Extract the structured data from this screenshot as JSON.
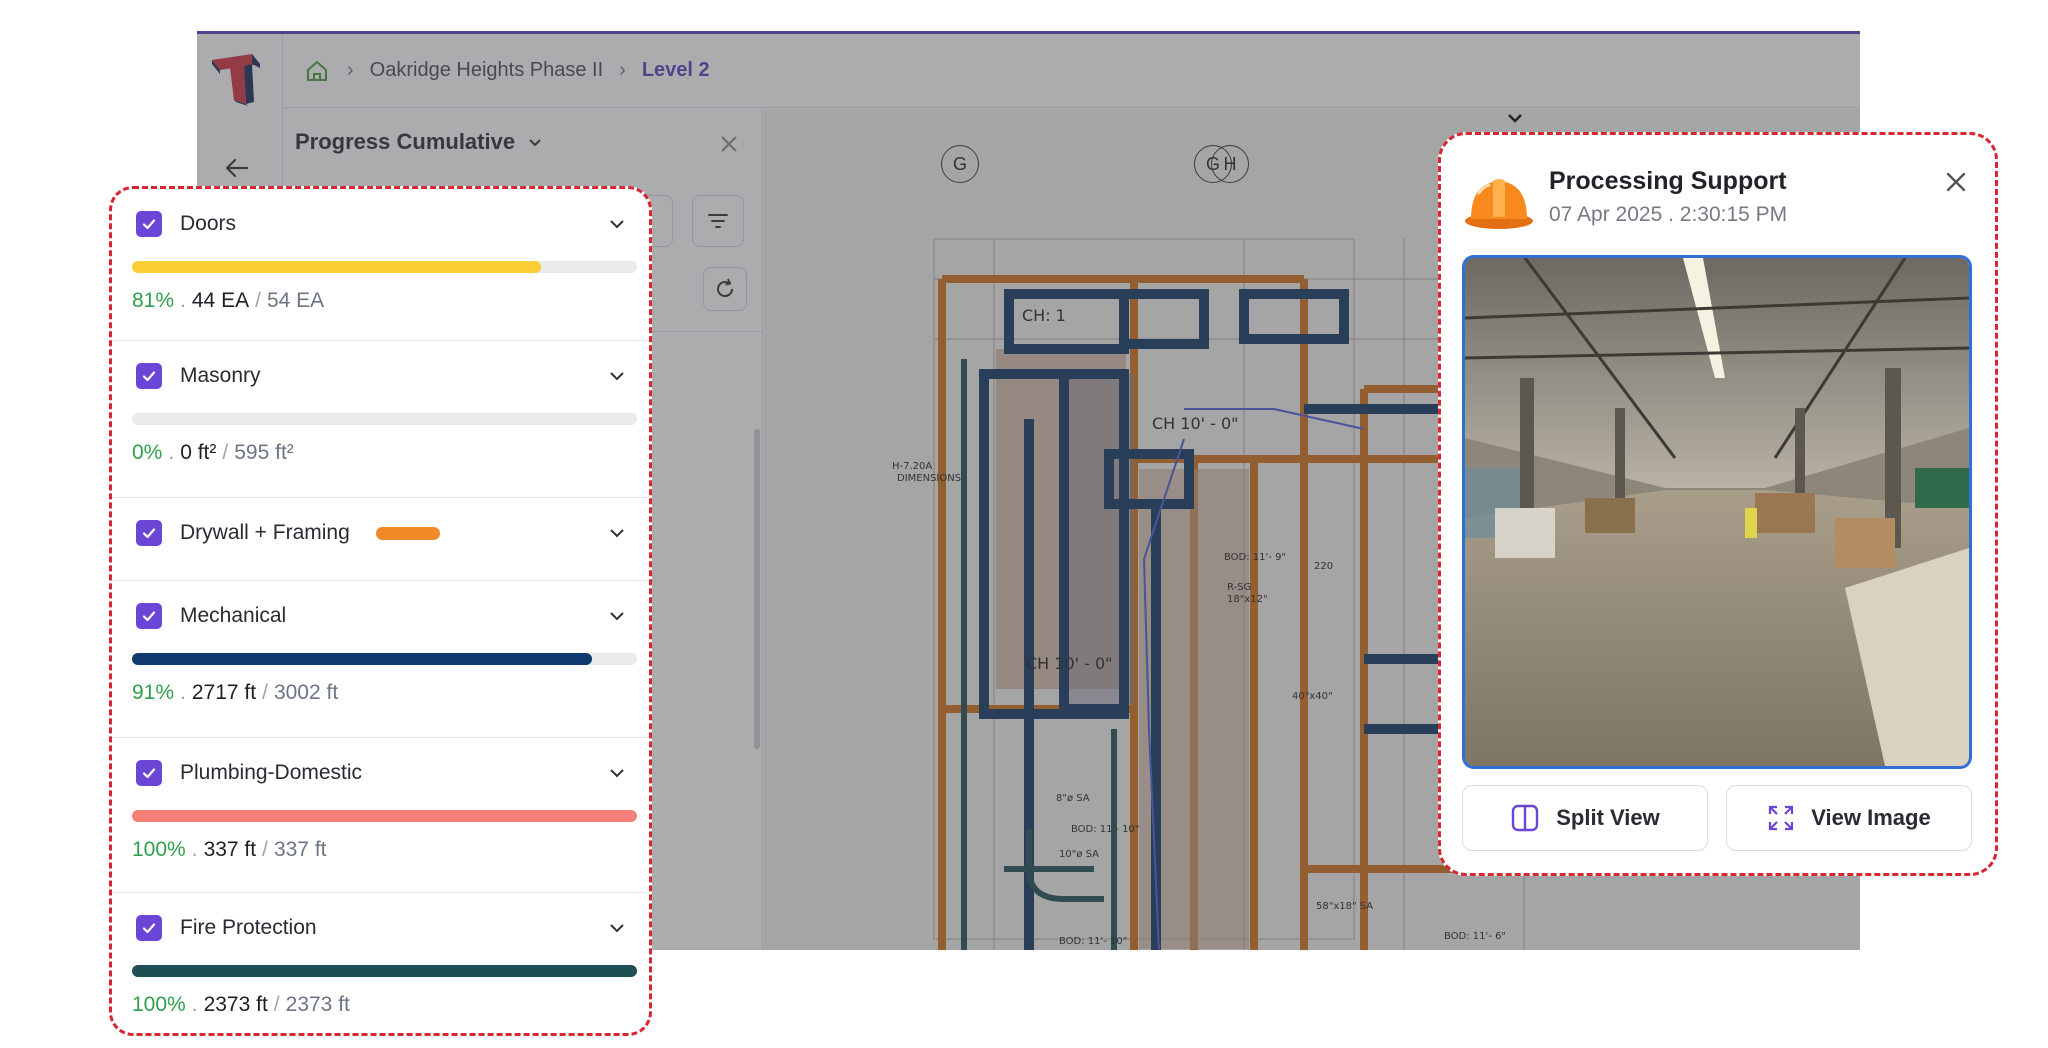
{
  "app": {
    "breadcrumb": {
      "project": "Oakridge Heights Phase II",
      "level": "Level 2"
    },
    "panel_title": "Progress Cumulative",
    "accent_color": "#5b3fbf"
  },
  "drawing": {
    "grid_bubbles": [
      "G",
      "G",
      "H"
    ],
    "annotations": {
      "ch1": "CH: 1",
      "ch2": "CH 10' - 0\"",
      "ch3": "CH 10' - 0\"",
      "bod1": "BOD: 11'- 9\"",
      "rsg": "R-SG",
      "rsg_size": "18\"x12\"",
      "sa": "8\"ø SA",
      "bod2": "BOD: 11'- 10\"",
      "sa2": "10\"ø SA",
      "bod3": "BOD: 11'- 10\"",
      "duct": "58\"x18\" SA",
      "bod4": "BOD: 11'- 6\"",
      "dim": "40\"x40\"",
      "room": "220",
      "h720": "H-7.20A",
      "dimens": "DIMENSIONS"
    }
  },
  "layers": [
    {
      "name": "Doors",
      "percent": "81%",
      "done": "44 EA",
      "total": "54 EA",
      "progress": 0.81,
      "color": "#f9cf33"
    },
    {
      "name": "Masonry",
      "percent": "0%",
      "done": "0 ft²",
      "total": "595 ft²",
      "progress": 0.0,
      "color": "#d9d9dd"
    },
    {
      "name": "Drywall + Framing",
      "swatch_color": "#f08a24"
    },
    {
      "name": "Mechanical",
      "percent": "91%",
      "done": "2717 ft",
      "total": "3002 ft",
      "progress": 0.91,
      "color": "#0e3a6e"
    },
    {
      "name": "Plumbing-Domestic",
      "percent": "100%",
      "done": "337 ft",
      "total": "337 ft",
      "progress": 1.0,
      "color": "#f47f77"
    },
    {
      "name": "Fire Protection",
      "percent": "100%",
      "done": "2373 ft",
      "total": "2373 ft",
      "progress": 1.0,
      "color": "#1f4f52"
    }
  ],
  "support": {
    "title": "Processing Support",
    "date": "07 Apr 2025 . 2:30:15 PM",
    "split_view": "Split View",
    "view_image": "View Image"
  },
  "colors": {
    "checkbox": "#6a45d6",
    "percent_text": "#2fa04c",
    "highlight_border": "#d62832",
    "photo_border": "#2f6fd6"
  },
  "icons": [
    "logo-icon",
    "home-icon",
    "back-arrow-icon",
    "chevron-down-icon",
    "close-icon",
    "filter-icon",
    "refresh-icon",
    "check-icon",
    "hardhat-icon",
    "split-view-icon",
    "expand-icon"
  ]
}
